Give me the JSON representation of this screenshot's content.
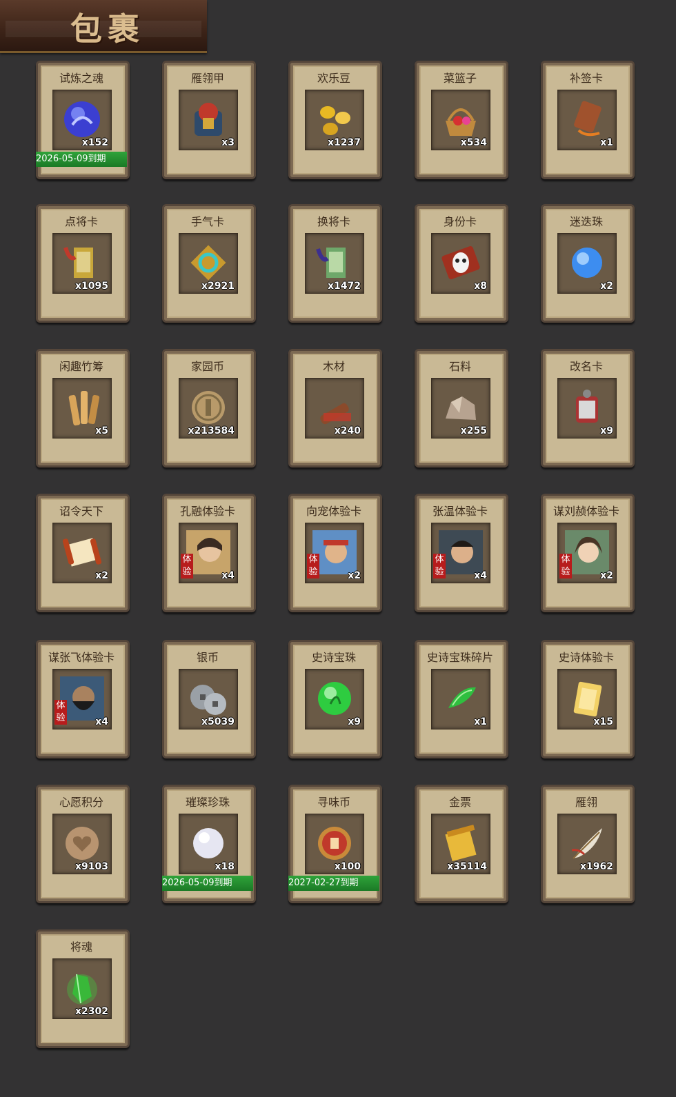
{
  "page_title": "包裹",
  "items": [
    {
      "name": "试炼之魂",
      "qty": "x152",
      "icon": "dragon-orb-icon",
      "expiry": "2026-05-09到期"
    },
    {
      "name": "雁翎甲",
      "qty": "x3",
      "icon": "armor-icon",
      "expiry": ""
    },
    {
      "name": "欢乐豆",
      "qty": "x1237",
      "icon": "gold-beans-icon",
      "expiry": ""
    },
    {
      "name": "菜篮子",
      "qty": "x534",
      "icon": "basket-icon",
      "expiry": ""
    },
    {
      "name": "补签卡",
      "qty": "x1",
      "icon": "tag-card-icon",
      "expiry": ""
    },
    {
      "name": "点将卡",
      "qty": "x1095",
      "icon": "general-card-icon",
      "expiry": ""
    },
    {
      "name": "手气卡",
      "qty": "x2921",
      "icon": "luck-card-icon",
      "expiry": ""
    },
    {
      "name": "换将卡",
      "qty": "x1472",
      "icon": "swap-card-icon",
      "expiry": ""
    },
    {
      "name": "身份卡",
      "qty": "x8",
      "icon": "mask-card-icon",
      "expiry": ""
    },
    {
      "name": "迷迭珠",
      "qty": "x2",
      "icon": "blue-orb-icon",
      "expiry": ""
    },
    {
      "name": "闲趣竹筹",
      "qty": "x5",
      "icon": "bamboo-tally-icon",
      "expiry": ""
    },
    {
      "name": "家园币",
      "qty": "x213584",
      "icon": "home-coin-icon",
      "expiry": ""
    },
    {
      "name": "木材",
      "qty": "x240",
      "icon": "wood-icon",
      "expiry": ""
    },
    {
      "name": "石料",
      "qty": "x255",
      "icon": "stone-icon",
      "expiry": ""
    },
    {
      "name": "改名卡",
      "qty": "x9",
      "icon": "rename-card-icon",
      "expiry": ""
    },
    {
      "name": "诏令天下",
      "qty": "x2",
      "icon": "scroll-icon",
      "expiry": ""
    },
    {
      "name": "孔融体验卡",
      "qty": "x4",
      "icon": "portrait-kongrong-icon",
      "expiry": "",
      "trial": "体验"
    },
    {
      "name": "向宠体验卡",
      "qty": "x2",
      "icon": "portrait-xiangchong-icon",
      "expiry": "",
      "trial": "体验"
    },
    {
      "name": "张温体验卡",
      "qty": "x4",
      "icon": "portrait-zhangwen-icon",
      "expiry": "",
      "trial": "体验"
    },
    {
      "name": "谋刘赪体验卡",
      "qty": "x2",
      "icon": "portrait-liucheng-icon",
      "expiry": "",
      "trial": "体验"
    },
    {
      "name": "谋张飞体验卡",
      "qty": "x4",
      "icon": "portrait-zhangfei-icon",
      "expiry": "",
      "trial": "体验"
    },
    {
      "name": "银币",
      "qty": "x5039",
      "icon": "silver-coins-icon",
      "expiry": ""
    },
    {
      "name": "史诗宝珠",
      "qty": "x9",
      "icon": "green-orb-icon",
      "expiry": ""
    },
    {
      "name": "史诗宝珠碎片",
      "qty": "x1",
      "icon": "green-shard-icon",
      "expiry": ""
    },
    {
      "name": "史诗体验卡",
      "qty": "x15",
      "icon": "gold-card-icon",
      "expiry": ""
    },
    {
      "name": "心愿积分",
      "qty": "x9103",
      "icon": "heart-coin-icon",
      "expiry": ""
    },
    {
      "name": "璀璨珍珠",
      "qty": "x18",
      "icon": "pearl-icon",
      "expiry": "2026-05-09到期"
    },
    {
      "name": "寻味币",
      "qty": "x100",
      "icon": "flavor-coin-icon",
      "expiry": "2027-02-27到期"
    },
    {
      "name": "金票",
      "qty": "x35114",
      "icon": "gold-ticket-icon",
      "expiry": ""
    },
    {
      "name": "雁翎",
      "qty": "x1962",
      "icon": "feather-icon",
      "expiry": ""
    },
    {
      "name": "将魂",
      "qty": "x2302",
      "icon": "green-crystal-icon",
      "expiry": ""
    }
  ],
  "colors": {
    "background": "#333233",
    "card": "#c9b995",
    "expiry_bar": "#2fa33a"
  }
}
